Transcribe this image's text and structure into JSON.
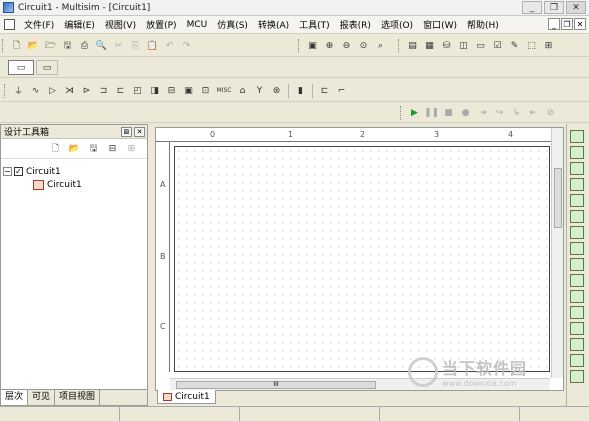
{
  "window": {
    "title": "Circuit1 - Multisim - [Circuit1]",
    "minimize": "_",
    "restore": "❐",
    "close": "✕"
  },
  "menubar": {
    "items": [
      "文件(F)",
      "编辑(E)",
      "视图(V)",
      "放置(P)",
      "MCU",
      "仿真(S)",
      "转换(A)",
      "工具(T)",
      "报表(R)",
      "选项(O)",
      "窗口(W)",
      "帮助(H)"
    ],
    "mdi_min": "_",
    "mdi_restore": "❐",
    "mdi_close": "✕"
  },
  "toolbars": {
    "standard": [
      "new-icon",
      "open-icon",
      "open-folder-icon",
      "save-icon",
      "print-icon",
      "print-preview-icon",
      "cut-icon",
      "copy-icon",
      "paste-icon",
      "undo-icon",
      "redo-icon"
    ],
    "zoom": [
      "fullscreen-icon",
      "zoom-in-icon",
      "zoom-out-icon",
      "zoom-area-icon",
      "zoom-fit-icon"
    ],
    "view": [
      "design-toolbox-icon",
      "spreadsheet-icon",
      "database-icon",
      "grapher-icon",
      "postprocessor-icon",
      "erc-icon",
      "component-wizard-icon",
      "breadboard-icon",
      "help-icon"
    ],
    "components": [
      "source-icon",
      "basic-icon",
      "diode-icon",
      "transistor-icon",
      "analog-icon",
      "ttl-icon",
      "cmos-icon",
      "mcu-icon",
      "advanced-peripherals-icon",
      "mixed-icon",
      "indicator-icon",
      "power-icon",
      "misc-icon",
      "rf-icon",
      "electromech-icon",
      "ladder-icon"
    ],
    "simulation": [
      "run-icon",
      "pause-icon",
      "stop-icon",
      "probe-icon",
      "step-icon",
      "step-over-icon",
      "step-into-icon",
      "step-out-icon",
      "breakpoint-icon"
    ],
    "misc_label": "MISC"
  },
  "design_toolbox": {
    "title": "设计工具箱",
    "tree": [
      {
        "label": "Circuit1",
        "expander": "−",
        "checked": "✓"
      },
      {
        "label": "Circuit1"
      }
    ],
    "tabs": [
      "层次",
      "可见",
      "项目视图"
    ]
  },
  "canvas": {
    "column_labels": [
      "0",
      "1",
      "2",
      "3",
      "4"
    ],
    "row_labels": [
      "A",
      "B",
      "C"
    ],
    "doc_tab": "Circuit1",
    "scroll_grip": "III"
  },
  "watermark": {
    "title": "当下软件园",
    "url": "www.downxia.com"
  }
}
